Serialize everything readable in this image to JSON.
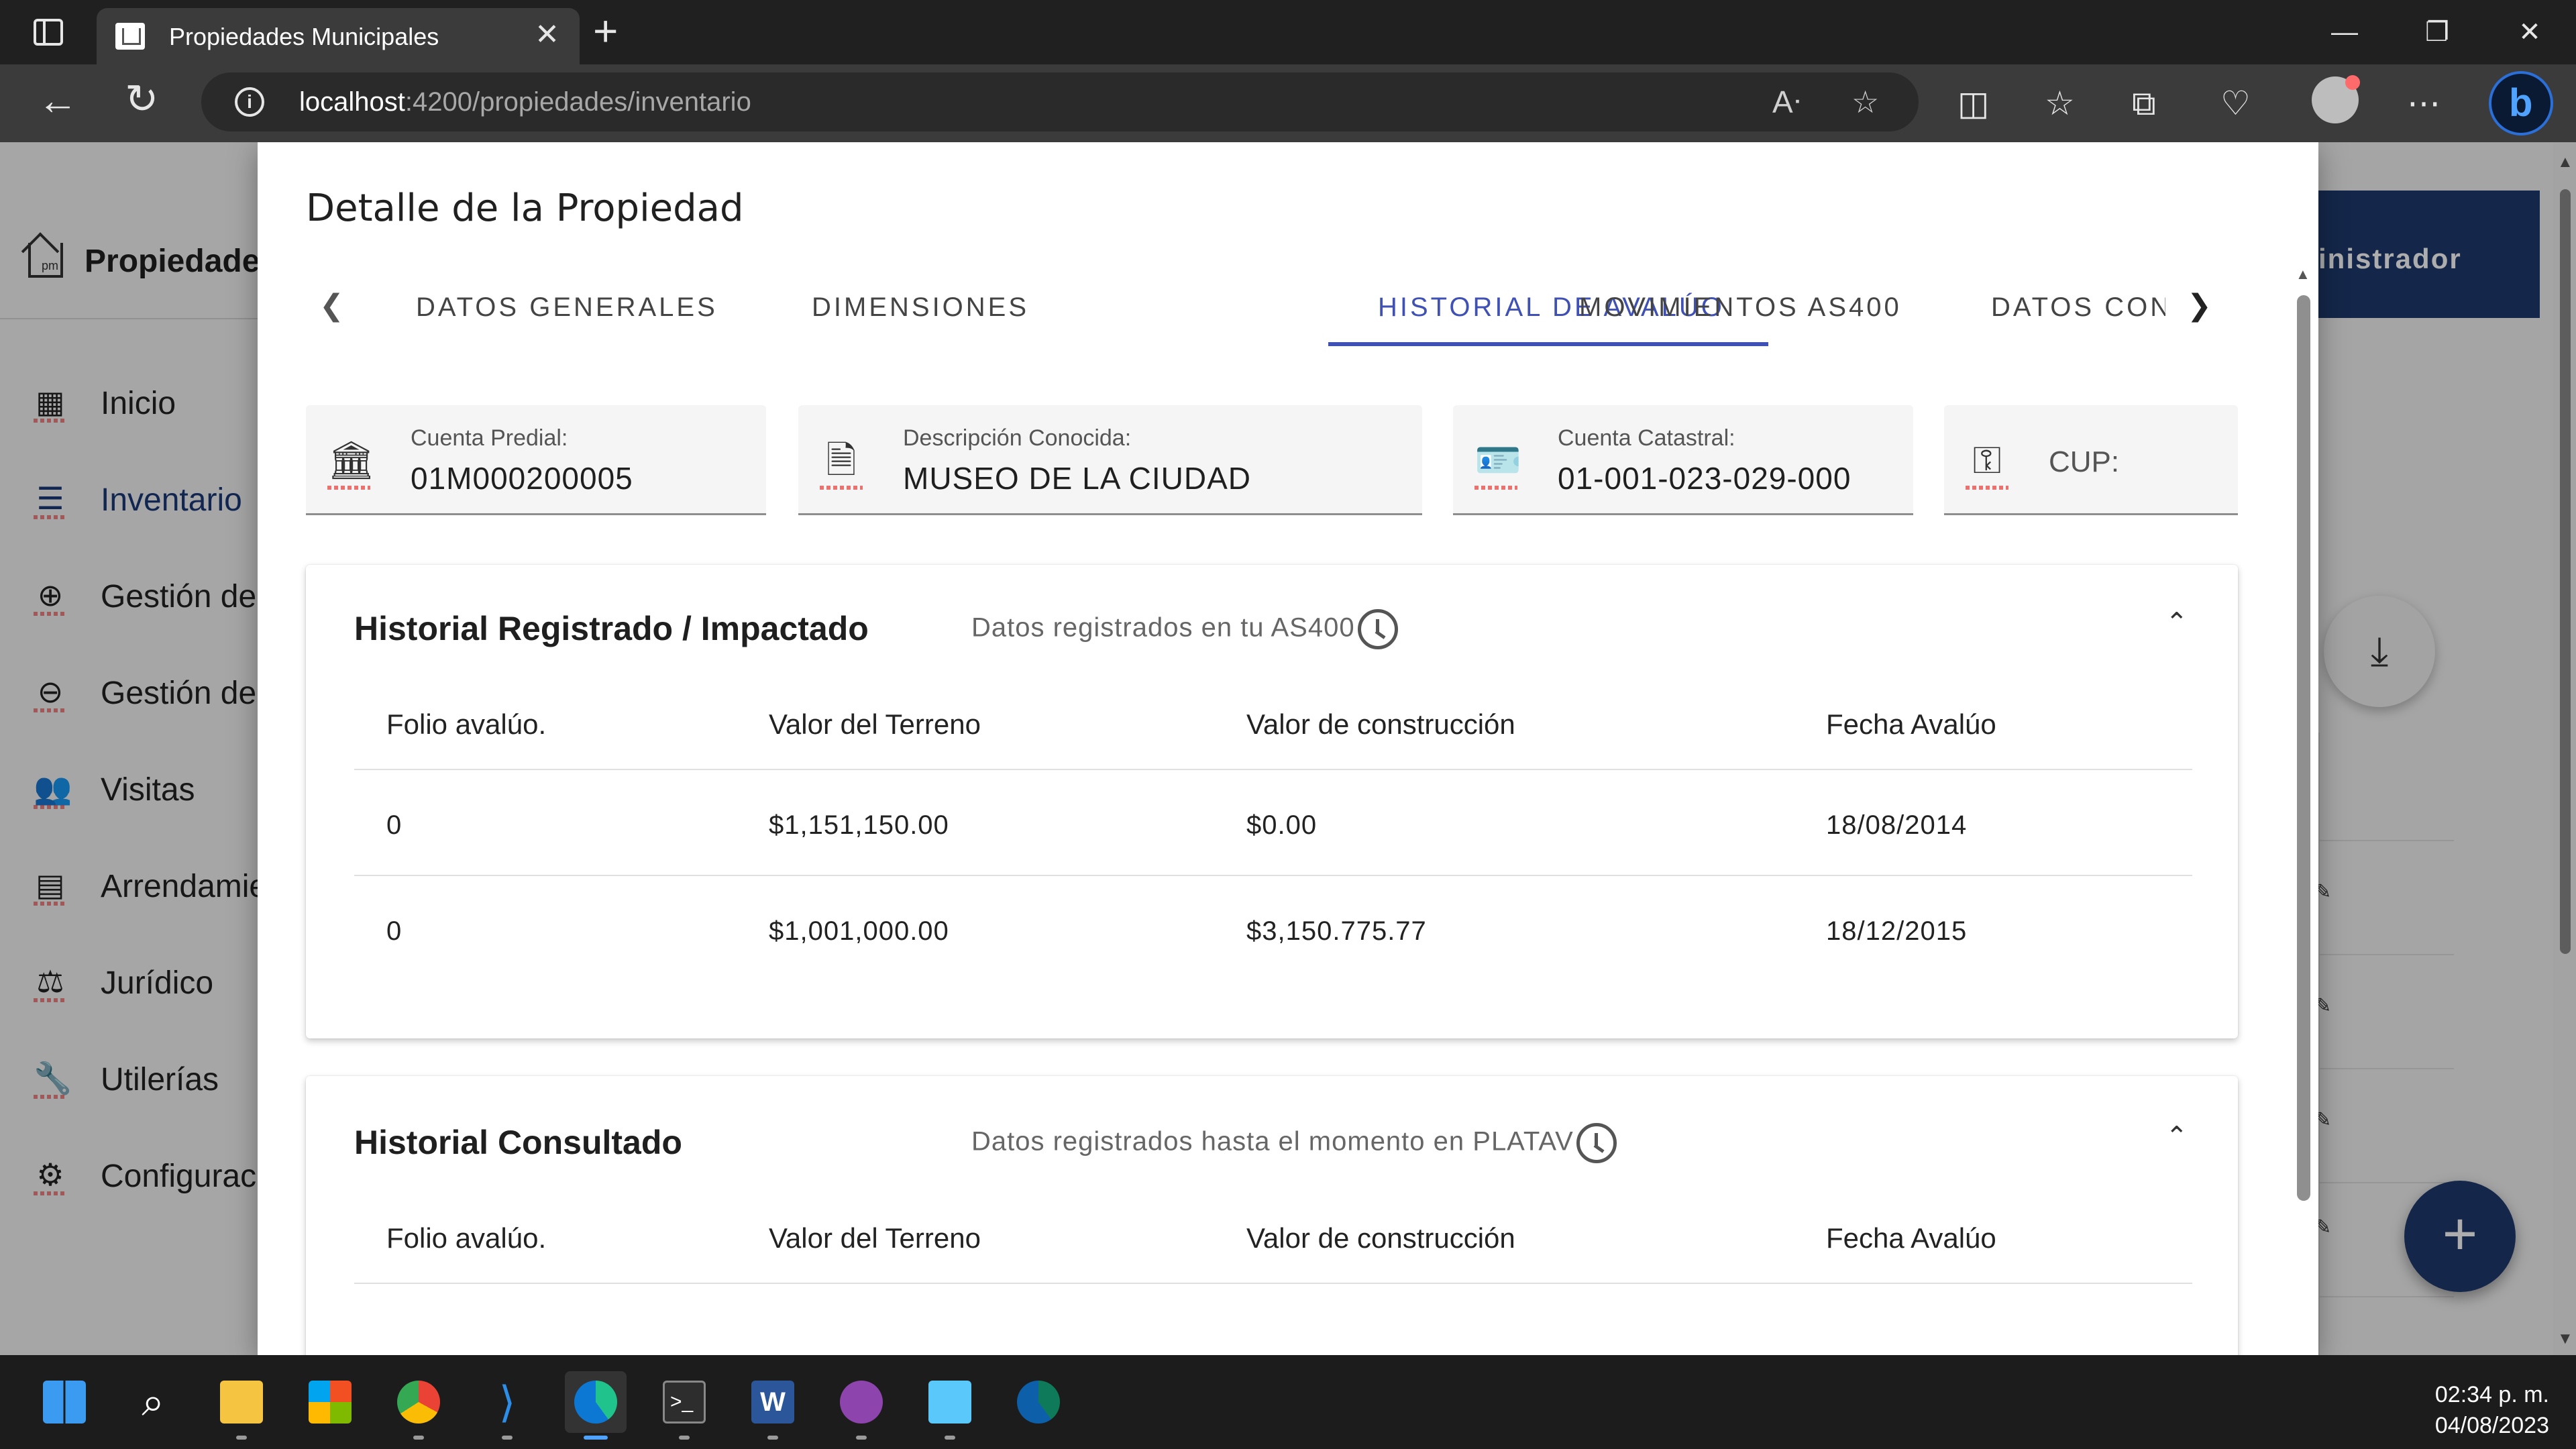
{
  "browser": {
    "tab_title": "Propiedades Municipales",
    "tab_close": "✕",
    "new_tab": "+",
    "url_host": "localhost",
    "url_path": ":4200/propiedades/inventario",
    "window_controls": {
      "minimize": "—",
      "maximize": "❐",
      "close": "✕"
    },
    "nav_back": "←",
    "nav_reload": "↻"
  },
  "sidebar": {
    "brand": "Propiedades",
    "items": [
      {
        "label": "Inicio",
        "icon": "dashboard-icon",
        "glyph": "▦"
      },
      {
        "label": "Inventario",
        "icon": "list-icon",
        "glyph": "☰"
      },
      {
        "label": "Gestión de",
        "icon": "add-circle-icon",
        "glyph": "⊕"
      },
      {
        "label": "Gestión de",
        "icon": "remove-circle-icon",
        "glyph": "⊖"
      },
      {
        "label": "Visitas",
        "icon": "people-icon",
        "glyph": "👥"
      },
      {
        "label": "Arrendamie",
        "icon": "store-icon",
        "glyph": "▤"
      },
      {
        "label": "Jurídico",
        "icon": "gavel-icon",
        "glyph": "⚖"
      },
      {
        "label": "Utilerías",
        "icon": "wrench-icon",
        "glyph": "🔧"
      },
      {
        "label": "Configurac",
        "icon": "settings-icon",
        "glyph": "⚙"
      }
    ]
  },
  "header": {
    "user_role": "inistrador"
  },
  "dialog": {
    "title": "Detalle de la Propiedad",
    "tabs": [
      {
        "label": "DATOS GENERALES"
      },
      {
        "label": "DIMENSIONES"
      },
      {
        "label": "HISTORIAL DE AVALÚO"
      },
      {
        "label": "MOVIMIENTOS AS400"
      },
      {
        "label": "DATOS CONT"
      }
    ],
    "active_tab": "HISTORIAL DE AVALÚO",
    "info_cards": [
      {
        "label": "Cuenta Predial:",
        "value": "01M000200005",
        "icon": "bank-icon"
      },
      {
        "label": "Descripción Conocida:",
        "value": "MUSEO DE LA CIUDAD",
        "icon": "document-icon"
      },
      {
        "label": "Cuenta Catastral:",
        "value": "01-001-023-029-000",
        "icon": "contact-card-icon"
      },
      {
        "label": "CUP:",
        "value": "",
        "icon": "key-icon"
      }
    ],
    "panels": [
      {
        "title": "Historial Registrado / Impactado",
        "description": "Datos registrados en tu AS400",
        "columns": [
          "Folio avalúo.",
          "Valor del Terreno",
          "Valor de construcción",
          "Fecha Avalúo"
        ],
        "rows": [
          [
            "0",
            "$1,151,150.00",
            "$0.00",
            "18/08/2014"
          ],
          [
            "0",
            "$1,001,000.00",
            "$3,150.775.77",
            "18/12/2015"
          ]
        ]
      },
      {
        "title": "Historial Consultado",
        "description": "Datos registrados hasta el momento en PLATAV",
        "columns": [
          "Folio avalúo.",
          "Valor del Terreno",
          "Valor de construcción",
          "Fecha Avalúo"
        ],
        "rows": []
      }
    ]
  },
  "taskbar": {
    "time": "02:34 p. m.",
    "date": "04/08/2023",
    "apps": [
      "start",
      "search",
      "file-explorer",
      "microsoft-store",
      "chrome",
      "vscode",
      "edge",
      "terminal",
      "word",
      "github-desktop",
      "notepad",
      "edge-dev"
    ]
  },
  "colors": {
    "primary": "#3f51b5",
    "navy": "#1e3a6e",
    "overlay": "rgba(0,0,0,0.32)"
  }
}
